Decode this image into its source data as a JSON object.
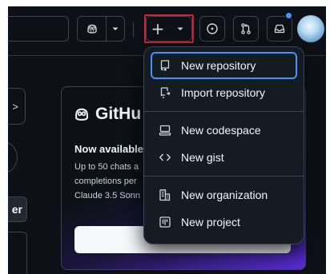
{
  "header": {
    "copilot_icon": "copilot-icon",
    "create_plus": "+",
    "create_caret": "triangle-down-icon",
    "issues_icon": "issue-opened-icon",
    "pulls_icon": "git-pull-request-icon",
    "inbox_icon": "inbox-icon",
    "notification_color": "#4493f8",
    "highlight_color": "#d1242f"
  },
  "left": {
    "chevron": ">",
    "button_label": "er"
  },
  "promo": {
    "brand": "GitHu",
    "title": "Now available",
    "line1": "Up to 50 chats a",
    "line2": "completions per",
    "line3": "Claude 3.5 Sonn"
  },
  "menu": {
    "items": [
      {
        "label": "New repository",
        "icon": "repo-icon"
      },
      {
        "label": "Import repository",
        "icon": "repo-push-icon"
      },
      {
        "label": "New codespace",
        "icon": "codespaces-icon"
      },
      {
        "label": "New gist",
        "icon": "code-icon"
      },
      {
        "label": "New organization",
        "icon": "organization-icon"
      },
      {
        "label": "New project",
        "icon": "project-icon"
      }
    ],
    "focus_color": "#4493f8"
  }
}
